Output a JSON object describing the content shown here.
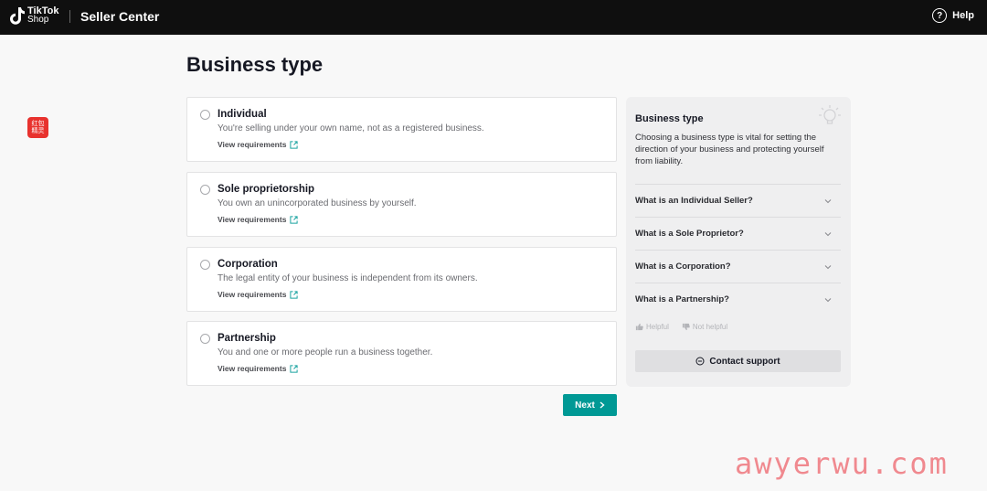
{
  "header": {
    "logo_line1": "TikTok",
    "logo_line2": "Shop",
    "app_title": "Seller Center",
    "help_label": "Help"
  },
  "side_badge": {
    "line1": "红包",
    "line2": "精灵"
  },
  "page": {
    "title": "Business type"
  },
  "options": [
    {
      "title": "Individual",
      "description": "You're selling under your own name, not as a registered business.",
      "link": "View requirements"
    },
    {
      "title": "Sole proprietorship",
      "description": "You own an unincorporated business by yourself.",
      "link": "View requirements"
    },
    {
      "title": "Corporation",
      "description": "The legal entity of your business is independent from its owners.",
      "link": "View requirements"
    },
    {
      "title": "Partnership",
      "description": "You and one or more people run a business together.",
      "link": "View requirements"
    }
  ],
  "next_label": "Next",
  "panel": {
    "title": "Business type",
    "description": "Choosing a business type is vital for setting the direction of your business and protecting yourself from liability.",
    "faqs": [
      "What is an Individual Seller?",
      "What is a Sole Proprietor?",
      "What is a Corporation?",
      "What is a Partnership?"
    ],
    "helpful_label": "Helpful",
    "not_helpful_label": "Not helpful",
    "contact_label": "Contact support"
  },
  "watermark": "awyerwu.com",
  "colors": {
    "accent": "#009995",
    "topbar": "#0f0f0f",
    "badge": "#e8322e"
  }
}
